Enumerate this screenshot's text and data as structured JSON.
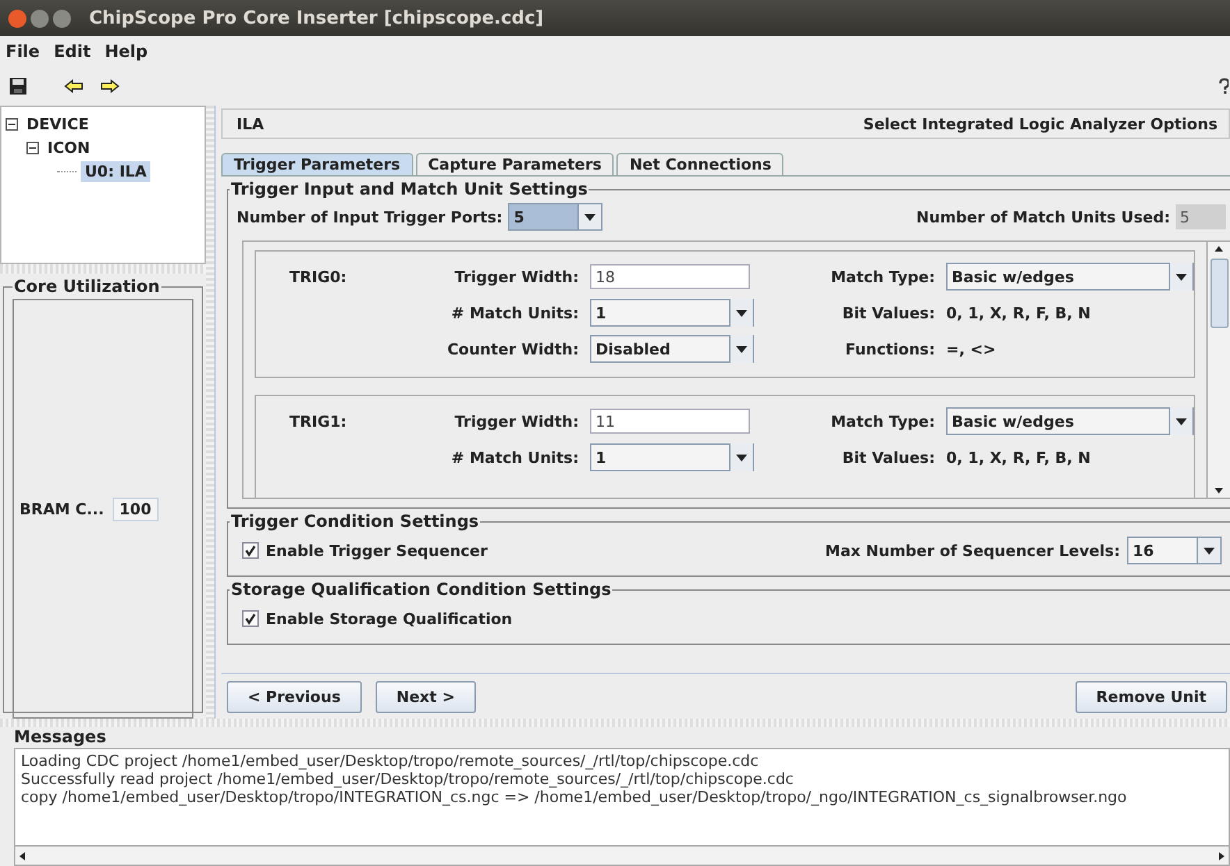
{
  "window": {
    "title": "ChipScope Pro Core Inserter [chipscope.cdc]"
  },
  "menu": [
    {
      "label": "File"
    },
    {
      "label": "Edit"
    },
    {
      "label": "Help"
    }
  ],
  "tree": [
    {
      "label": "DEVICE",
      "expanded": true,
      "selected": false,
      "children": [
        {
          "label": "ICON",
          "expanded": true,
          "selected": false,
          "children": [
            {
              "label": "U0: ILA",
              "selected": true
            }
          ]
        }
      ]
    }
  ],
  "core_utilization": {
    "title": "Core Utilization",
    "items": [
      {
        "label": "BRAM C...",
        "value": "100"
      }
    ]
  },
  "header": {
    "left": "ILA",
    "right": "Select Integrated Logic Analyzer Options"
  },
  "tabs": [
    {
      "label": "Trigger Parameters",
      "selected": true
    },
    {
      "label": "Capture Parameters",
      "selected": false
    },
    {
      "label": "Net Connections",
      "selected": false
    }
  ],
  "trigger_input": {
    "title": "Trigger Input and Match Unit Settings",
    "ports_label": "Number of Input Trigger Ports:",
    "ports_value": "5",
    "match_used_label": "Number of Match Units Used:",
    "match_used_value": "5",
    "triggers": [
      {
        "name": "TRIG0:",
        "rows": [
          {
            "left": {
              "label": "Trigger Width:",
              "kind": "text",
              "value": "18"
            },
            "right": {
              "label": "Match Type:",
              "kind": "combo",
              "value": "Basic w/edges"
            }
          },
          {
            "left": {
              "label": "# Match Units:",
              "kind": "combo",
              "value": "1"
            },
            "right": {
              "label": "Bit Values:",
              "kind": "plain",
              "value": "0, 1, X, R, F, B, N"
            }
          },
          {
            "left": {
              "label": "Counter Width:",
              "kind": "combo",
              "value": "Disabled"
            },
            "right": {
              "label": "Functions:",
              "kind": "plain",
              "value": "=, <>"
            }
          }
        ]
      },
      {
        "name": "TRIG1:",
        "rows": [
          {
            "left": {
              "label": "Trigger Width:",
              "kind": "text",
              "value": "11"
            },
            "right": {
              "label": "Match Type:",
              "kind": "combo",
              "value": "Basic w/edges"
            }
          },
          {
            "left": {
              "label": "# Match Units:",
              "kind": "combo",
              "value": "1"
            },
            "right": {
              "label": "Bit Values:",
              "kind": "plain",
              "value": "0, 1, X, R, F, B, N"
            }
          }
        ]
      }
    ]
  },
  "trigger_condition": {
    "title": "Trigger Condition Settings",
    "checkbox": {
      "label": "Enable Trigger Sequencer",
      "checked": true
    },
    "levels_label": "Max Number of Sequencer Levels:",
    "levels_value": "16"
  },
  "storage_condition": {
    "title": "Storage Qualification Condition Settings",
    "checkbox": {
      "label": "Enable Storage Qualification",
      "checked": true
    }
  },
  "buttons": {
    "previous": "< Previous",
    "next": "Next >",
    "remove": "Remove Unit"
  },
  "messages": {
    "title": "Messages",
    "lines": [
      "Loading CDC project /home1/embed_user/Desktop/tropo/remote_sources/_/rtl/top/chipscope.cdc",
      "Successfully read project /home1/embed_user/Desktop/tropo/remote_sources/_/rtl/top/chipscope.cdc",
      "copy /home1/embed_user/Desktop/tropo/INTEGRATION_cs.ngc => /home1/embed_user/Desktop/tropo/_ngo/INTEGRATION_cs_signalbrowser.ngo"
    ]
  }
}
